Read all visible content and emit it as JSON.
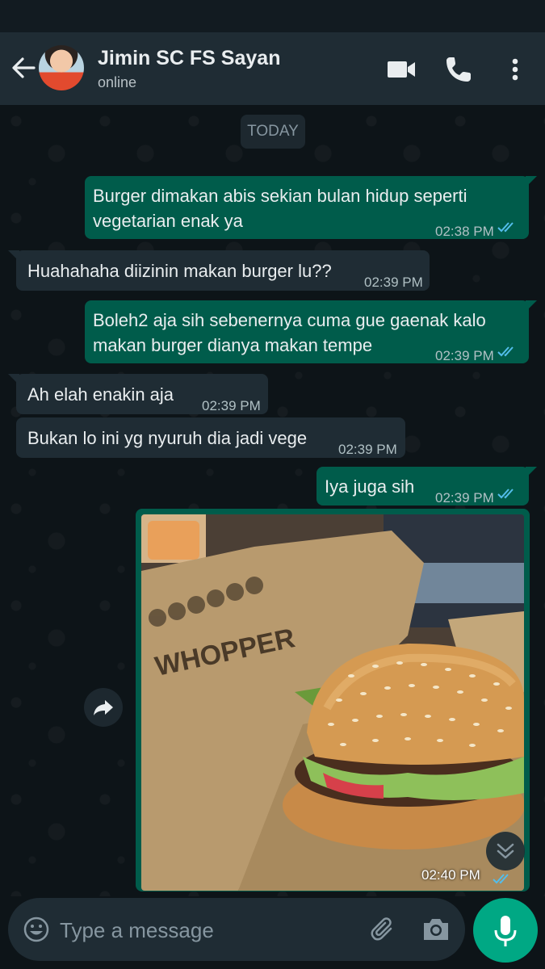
{
  "header": {
    "contact_name": "Jimin SC FS Sayan",
    "status": "online"
  },
  "chat": {
    "date_label": "TODAY",
    "messages": [
      {
        "dir": "out",
        "lines": [
          "Burger dimakan abis sekian bulan hidup seperti",
          "vegetarian enak ya"
        ],
        "time": "02:38 PM",
        "read": true
      },
      {
        "dir": "in",
        "lines": [
          "Huahahaha diizinin makan burger lu??"
        ],
        "time": "02:39 PM"
      },
      {
        "dir": "out",
        "lines": [
          "Boleh2 aja sih sebenernya cuma gue gaenak kalo",
          "makan burger dianya makan tempe"
        ],
        "time": "02:39 PM",
        "read": true
      },
      {
        "dir": "in",
        "lines": [
          "Ah elah enakin aja"
        ],
        "time": "02:39 PM"
      },
      {
        "dir": "in",
        "lines": [
          "Bukan lo ini yg nyuruh dia jadi vege"
        ],
        "time": "02:39 PM"
      },
      {
        "dir": "out",
        "lines": [
          "Iya juga sih"
        ],
        "time": "02:39 PM",
        "read": true
      }
    ],
    "image_message": {
      "time": "02:40 PM",
      "read": true,
      "wrapper_text": "WHOPPER"
    }
  },
  "composer": {
    "placeholder": "Type a message"
  },
  "icons": {
    "back": "back-arrow-icon",
    "video": "video-call-icon",
    "call": "phone-icon",
    "menu": "more-vert-icon",
    "emoji": "emoji-icon",
    "attach": "paperclip-icon",
    "camera": "camera-icon",
    "mic": "mic-icon",
    "forward": "forward-icon",
    "scroll_down": "double-chevron-down-icon"
  },
  "colors": {
    "outgoing_bubble": "#005c4b",
    "incoming_bubble": "#1f2c34",
    "accent": "#00a884",
    "read_ticks": "#53bdeb"
  }
}
